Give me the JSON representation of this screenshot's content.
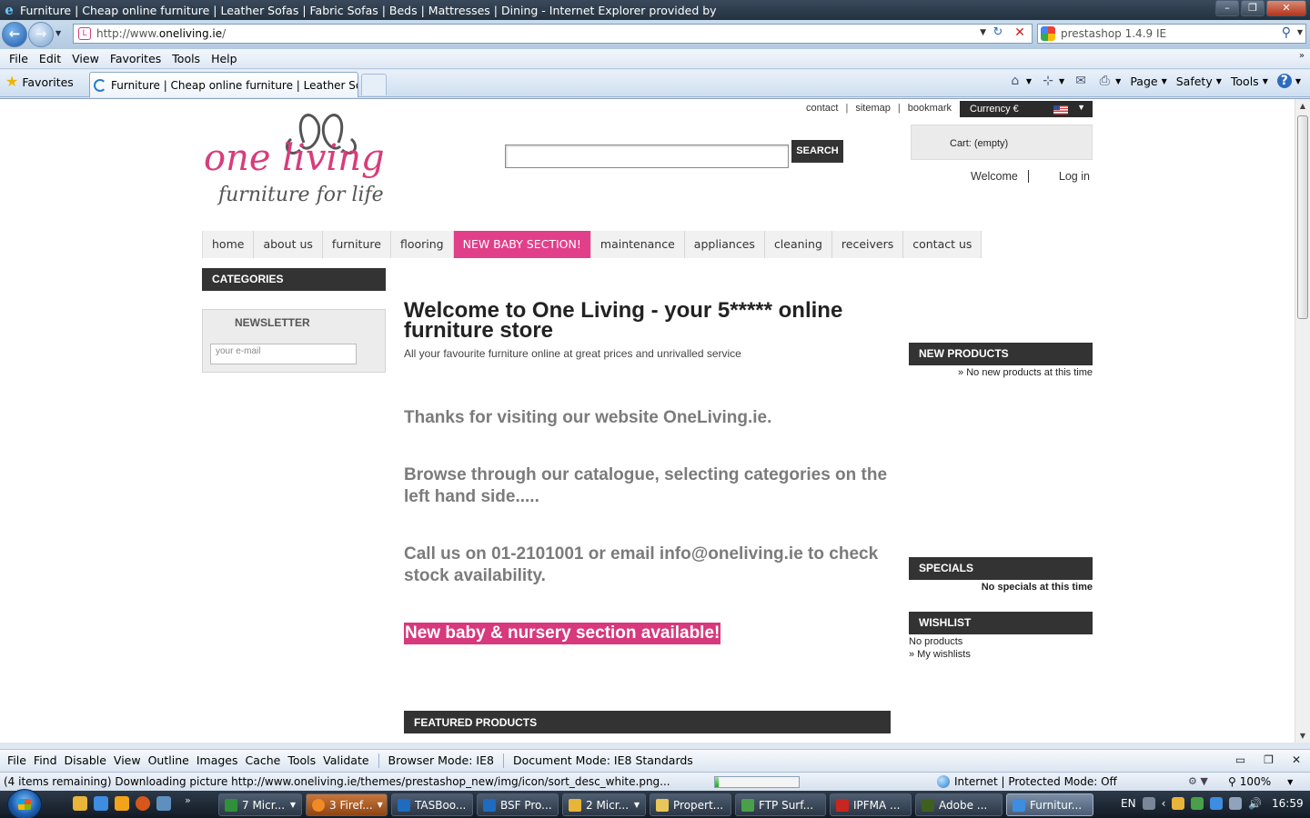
{
  "window": {
    "title": "Furniture | Cheap online furniture | Leather Sofas | Fabric Sofas | Beds | Mattresses | Dining  - Internet Explorer provided by"
  },
  "address_bar": {
    "url_prefix": "http://www.",
    "url_domain": "oneliving.ie",
    "url_suffix": "/",
    "search_value": "prestashop 1.4.9 IE"
  },
  "menu": [
    "File",
    "Edit",
    "View",
    "Favorites",
    "Tools",
    "Help"
  ],
  "favorites_label": "Favorites",
  "tab_title": "Furniture | Cheap online furniture | Leather Sofas ...",
  "command_bar": {
    "page": "Page",
    "safety": "Safety",
    "tools": "Tools"
  },
  "site": {
    "logo_top": "one living",
    "logo_bottom": "furniture for life",
    "top_links": [
      "contact",
      "sitemap",
      "bookmark"
    ],
    "currency_label": "Currency €",
    "search_button": "SEARCH",
    "cart_text": "Cart: (empty)",
    "welcome_label": "Welcome",
    "login_label": "Log in",
    "nav": [
      "home",
      "about us",
      "furniture",
      "flooring",
      "NEW BABY SECTION!",
      "maintenance",
      "appliances",
      "cleaning",
      "receivers",
      "contact us"
    ],
    "categories_heading": "CATEGORIES",
    "newsletter_heading": "NEWSLETTER",
    "newsletter_placeholder": "your e-mail",
    "welcome_heading": "Welcome to One Living - your 5***** online furniture store",
    "tagline": "All your favourite furniture online at great prices and unrivalled service",
    "msg1": "Thanks for visiting our website OneLiving.ie.",
    "msg2": "Browse through our catalogue, selecting categories on the left hand side.....",
    "msg3": "Call us on 01-2101001 or email info@oneliving.ie to check stock availability.",
    "baby_banner": "New baby & nursery section available!",
    "featured_heading": "FEATURED PRODUCTS",
    "new_products_heading": "NEW PRODUCTS",
    "new_products_text": "» No new products at this time",
    "specials_heading": "SPECIALS",
    "specials_text": "No specials at this time",
    "wishlist_heading": "WISHLIST",
    "wishlist_text": "No products",
    "wishlist_link": "» My wishlists"
  },
  "dev_toolbar": {
    "items": [
      "File",
      "Find",
      "Disable",
      "View",
      "Outline",
      "Images",
      "Cache",
      "Tools",
      "Validate"
    ],
    "browser_mode": "Browser Mode: IE8",
    "document_mode": "Document Mode: IE8 Standards"
  },
  "status_bar": {
    "text": "(4 items remaining) Downloading picture http://www.oneliving.ie/themes/prestashop_new/img/icon/sort_desc_white.png...",
    "progress": 0.04,
    "zone": "Internet | Protected Mode: Off",
    "zoom": "100%"
  },
  "taskbar": {
    "tasks": [
      "7 Micr...",
      "3 Firef...",
      "TASBoo...",
      "BSF Pro...",
      "2 Micr...",
      "Propert...",
      "FTP Surf...",
      "IPFMA ...",
      "Adobe ...",
      "Furnitur..."
    ],
    "language": "EN",
    "clock": "16:59"
  },
  "colors": {
    "brand_pink": "#e23f8a",
    "dark_header": "#333333",
    "msg_gray": "#7b7b7b"
  }
}
